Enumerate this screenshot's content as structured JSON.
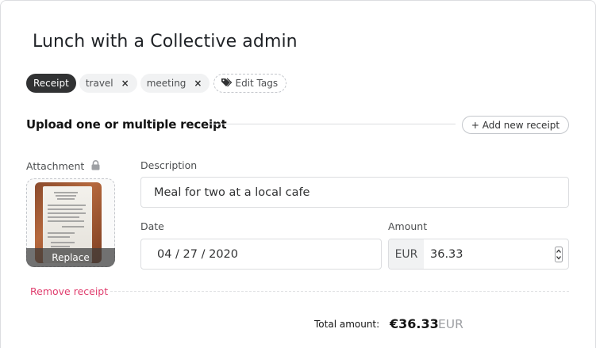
{
  "expense": {
    "title": "Lunch with a Collective admin"
  },
  "tags": {
    "items": [
      {
        "label": "Receipt",
        "removable": false,
        "active": true
      },
      {
        "label": "travel",
        "removable": true,
        "active": false
      },
      {
        "label": "meeting",
        "removable": true,
        "active": false
      }
    ],
    "remove_symbol": "×",
    "edit_label": "Edit Tags"
  },
  "upload_section": {
    "title": "Upload one or multiple receipt",
    "add_button_label": "+ Add new receipt"
  },
  "item": {
    "attachment_label": "Attachment",
    "replace_label": "Replace",
    "description_label": "Description",
    "description_value": "Meal for two at a local cafe",
    "date_label": "Date",
    "date_value": "04 / 27 / 2020",
    "amount_label": "Amount",
    "amount_currency": "EUR",
    "amount_value": "36.33",
    "remove_label": "Remove receipt"
  },
  "total": {
    "label": "Total amount:",
    "value": "€36.33",
    "currency": "EUR"
  },
  "icons": {
    "remove_tag": "close-icon",
    "edit_tags": "tag-icon",
    "attachment_lock": "lock-icon",
    "stepper": "stepper-icon"
  },
  "colors": {
    "accent_danger": "#e03f6f",
    "tag_active_bg": "#313233",
    "tag_bg": "#f1f2f3",
    "border": "#dcdde0",
    "muted_text": "#9d9fa3"
  }
}
